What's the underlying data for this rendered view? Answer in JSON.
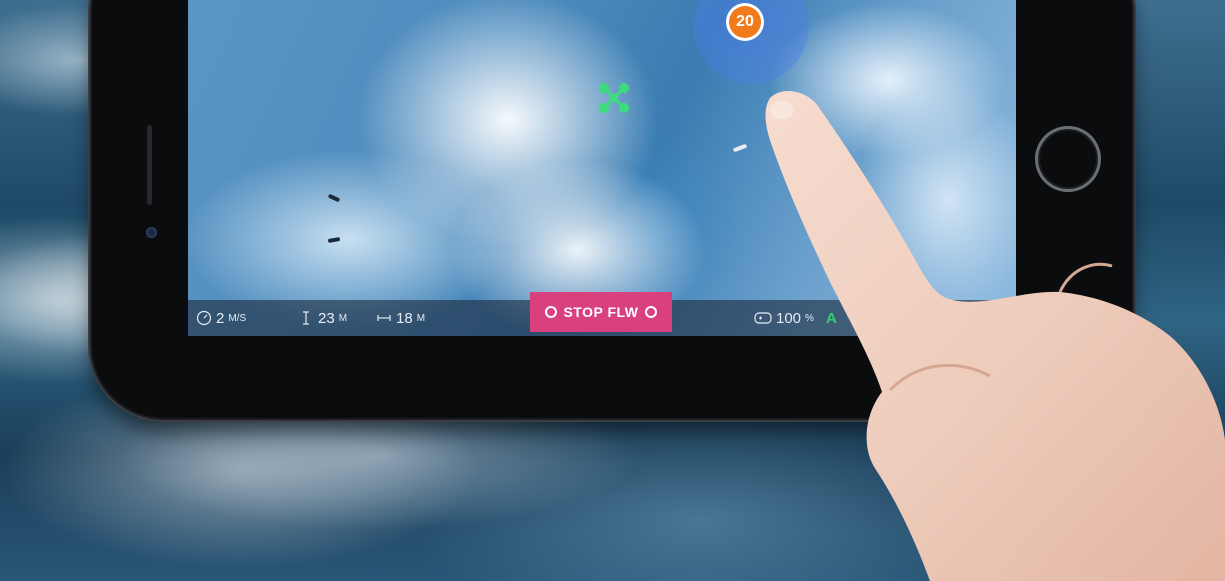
{
  "target": {
    "badge_label": "20"
  },
  "telemetry": {
    "speed": {
      "value": "2",
      "unit": "M/S"
    },
    "height": {
      "value": "23",
      "unit": "M"
    },
    "distance": {
      "value": "18",
      "unit": "M"
    },
    "battery": {
      "value": "100",
      "unit": "%"
    },
    "mode_indicator": "A"
  },
  "controls": {
    "stop_follow_label": "STOP FLW"
  },
  "icons": {
    "speed": "speedometer-icon",
    "height": "height-icon",
    "distance": "distance-icon",
    "controller": "gamepad-icon",
    "drone": "drone-icon",
    "stop_follow_left": "refresh-icon",
    "stop_follow_right": "refresh-icon"
  },
  "colors": {
    "target_badge": "#f07a1c",
    "target_ring": "#4b7de6",
    "stop_follow_button": "#d9417e",
    "mode_indicator": "#35d06b",
    "drone_icon": "#3ddc7a"
  }
}
